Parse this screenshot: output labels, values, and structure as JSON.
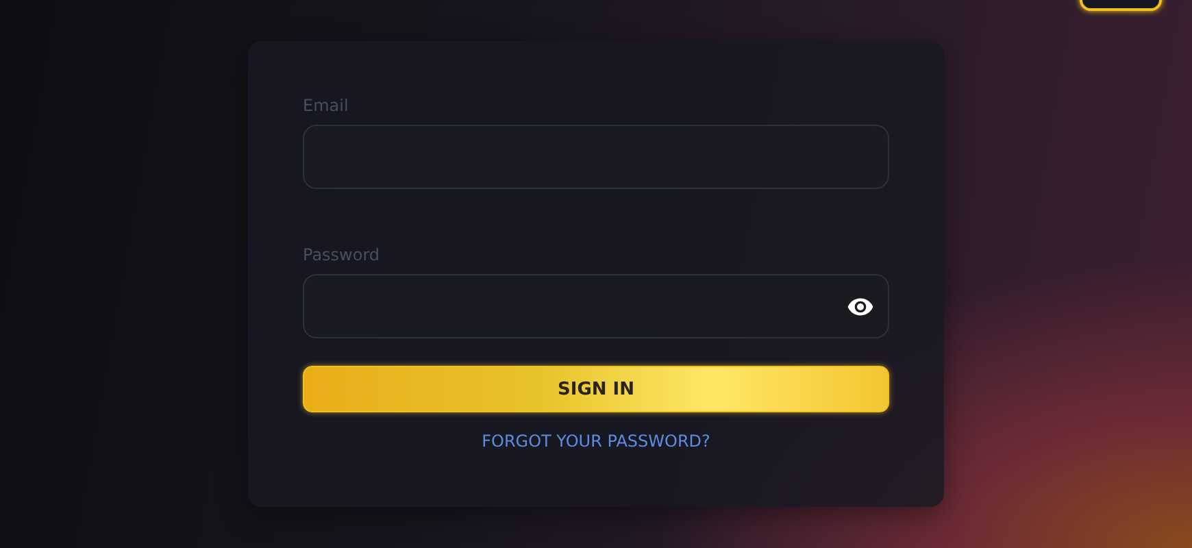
{
  "form": {
    "fields": [
      {
        "kind": "text",
        "label": "Email"
      },
      {
        "kind": "password",
        "label": "Password"
      }
    ],
    "submit": "SIGN IN",
    "forgot_link": "FORGOT YOUR PASSWORD?"
  }
}
